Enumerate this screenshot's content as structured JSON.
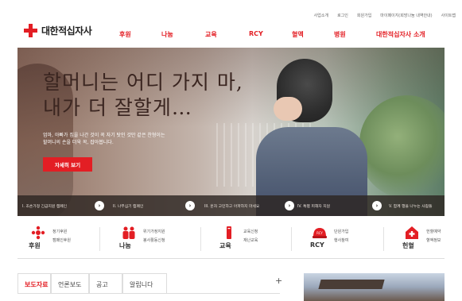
{
  "util_links": [
    "사업소개",
    "로그인",
    "회원가입",
    "마이페이지(희망나눔 내역안내)",
    "사이트맵"
  ],
  "brand": {
    "name": "대한적십자사",
    "color": "#e31e24"
  },
  "gnb": [
    "후원",
    "나눔",
    "교육",
    "RCY",
    "혈액",
    "병원",
    "대한적십자사 소개"
  ],
  "hero": {
    "headline_1": "할머니는 어디 가지 마,",
    "headline_2": "내가 더 잘할게…",
    "sub_1": "엄마, 아빠가 집을 나간 것이 꼭 자기 탓인 것만 같은 찬형이는",
    "sub_2": "할머니의 손을 더욱 꼭, 잡아봅니다.",
    "more_label": "자세히 보기"
  },
  "campaigns": [
    "I. 조손가정 긴급지원 캠페인",
    "II. 나무심기 캠페인",
    "III. 혼자 고민하고 아파하지 마세요",
    "IV. 특별 피해자 지원",
    "V. 함께 행을 나누는 사람들"
  ],
  "quick_menu": [
    {
      "icon": "donation-icon",
      "title": "후원",
      "links": [
        "정기후원",
        "캠페인후원"
      ]
    },
    {
      "icon": "sharing-icon",
      "title": "나눔",
      "links": [
        "위기가정지원",
        "봉사활동신청"
      ]
    },
    {
      "icon": "education-icon",
      "title": "교육",
      "links": [
        "교육신청",
        "재난교육"
      ]
    },
    {
      "icon": "rcy-icon",
      "title": "RCY",
      "links": [
        "단원가입",
        "행사참여"
      ]
    },
    {
      "icon": "blood-icon",
      "title": "헌혈",
      "links": [
        "헌혈예약",
        "혈액정보"
      ]
    }
  ],
  "tabs": [
    "보도자료",
    "언론보도",
    "공고",
    "알립니다"
  ],
  "plus_label": "+"
}
